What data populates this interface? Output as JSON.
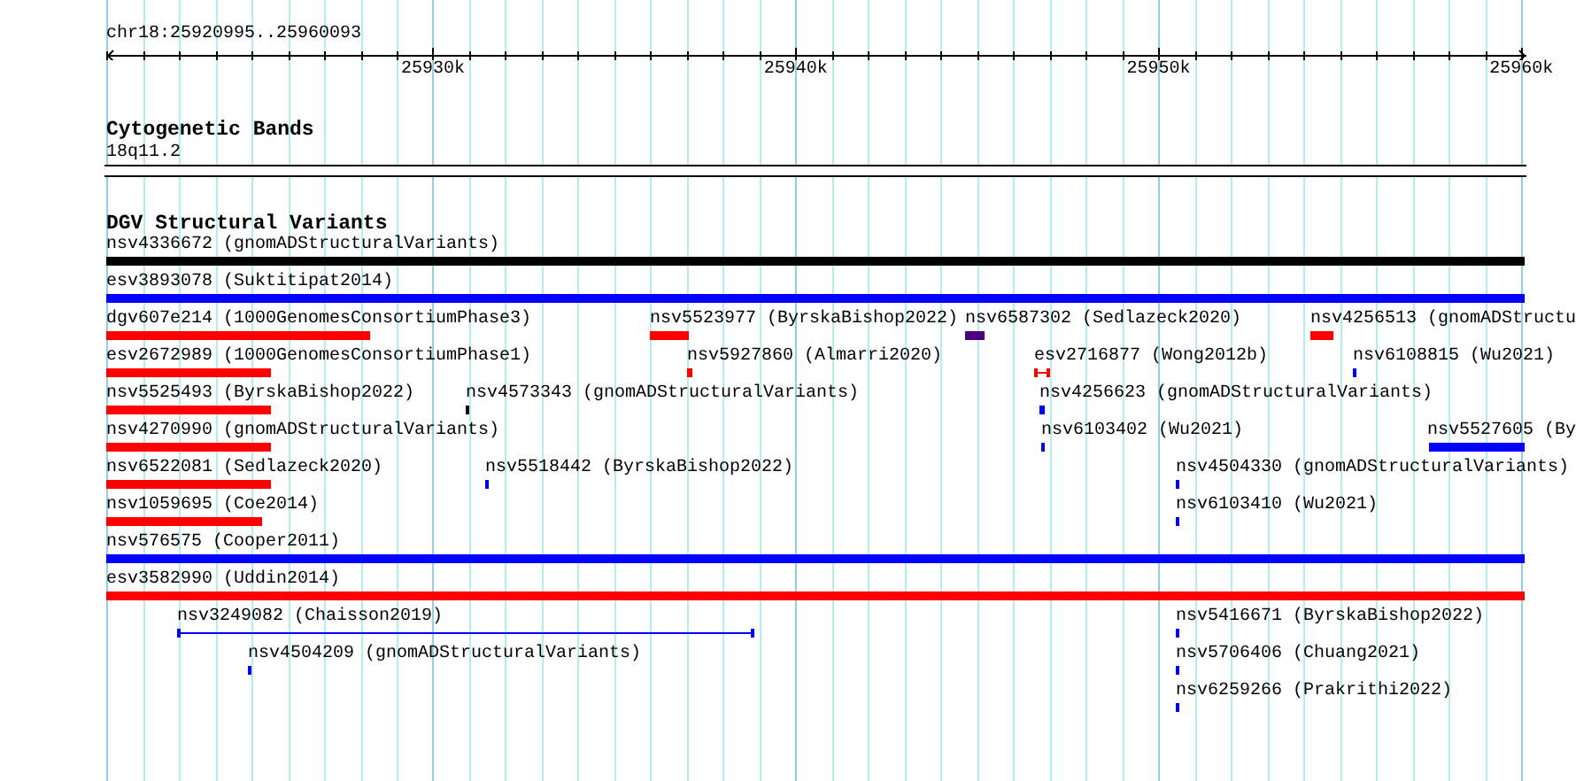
{
  "ruler": {
    "location": "chr18:25920995..25960093",
    "ticks": [
      {
        "label": "25930k"
      },
      {
        "label": "25940k"
      },
      {
        "label": "25950k"
      },
      {
        "label": "25960k"
      }
    ]
  },
  "tracks": [
    {
      "title": "Cytogenetic Bands",
      "kind": "cytoband",
      "bands": [
        {
          "label": "18q11.2"
        }
      ]
    },
    {
      "title": "DGV Structural Variants",
      "kind": "variants",
      "rows": [
        [
          {
            "label": "nsv4336672 (gnomADStructuralVariants)",
            "color": "#000000",
            "kind": "bar"
          }
        ],
        [
          {
            "label": "esv3893078 (Suktitipat2014)",
            "color": "#0000ff",
            "kind": "bar"
          }
        ],
        [
          {
            "label": "dgv607e214 (1000GenomesConsortiumPhase3)",
            "color": "#ff0000",
            "kind": "bar"
          },
          {
            "label": "nsv5523977 (ByrskaBishop2022)",
            "color": "#ff0000",
            "kind": "bar"
          },
          {
            "label": "nsv6587302 (Sedlazeck2020)",
            "color": "#4b0082",
            "kind": "bar"
          },
          {
            "label": "nsv4256513 (gnomADStructu",
            "color": "#ff0000",
            "kind": "bar"
          }
        ],
        [
          {
            "label": "esv2672989 (1000GenomesConsortiumPhase1)",
            "color": "#ff0000",
            "kind": "bar"
          },
          {
            "label": "nsv5927860 (Almarri2020)",
            "color": "#ff0000",
            "kind": "bar"
          },
          {
            "label": "esv2716877 (Wong2012b)",
            "color": "#ff0000",
            "kind": "span"
          },
          {
            "label": "nsv6108815 (Wu2021)",
            "color": "#0000ff",
            "kind": "bar"
          }
        ],
        [
          {
            "label": "nsv5525493 (ByrskaBishop2022)",
            "color": "#ff0000",
            "kind": "bar"
          },
          {
            "label": "nsv4573343 (gnomADStructuralVariants)",
            "color": "#000000",
            "kind": "bar"
          },
          {
            "label": "nsv4256623 (gnomADStructuralVariants)",
            "color": "#0000ff",
            "kind": "bar"
          }
        ],
        [
          {
            "label": "nsv4270990 (gnomADStructuralVariants)",
            "color": "#ff0000",
            "kind": "bar"
          },
          {
            "label": "nsv6103402 (Wu2021)",
            "color": "#0000ff",
            "kind": "bar"
          },
          {
            "label": "nsv5527605 (By",
            "color": "#0000ff",
            "kind": "bar"
          }
        ],
        [
          {
            "label": "nsv6522081 (Sedlazeck2020)",
            "color": "#ff0000",
            "kind": "bar"
          },
          {
            "label": "nsv5518442 (ByrskaBishop2022)",
            "color": "#0000ff",
            "kind": "bar"
          },
          {
            "label": "nsv4504330 (gnomADStructuralVariants)",
            "color": "#0000ff",
            "kind": "bar"
          }
        ],
        [
          {
            "label": "nsv1059695 (Coe2014)",
            "color": "#ff0000",
            "kind": "bar"
          },
          {
            "label": "nsv6103410 (Wu2021)",
            "color": "#0000ff",
            "kind": "bar"
          }
        ],
        [
          {
            "label": "nsv576575 (Cooper2011)",
            "color": "#0000ff",
            "kind": "bar"
          }
        ],
        [
          {
            "label": "esv3582990 (Uddin2014)",
            "color": "#ff0000",
            "kind": "bar"
          }
        ],
        [
          {
            "label": "nsv3249082 (Chaisson2019)",
            "color": "#0000ff",
            "kind": "span"
          },
          {
            "label": "nsv5416671 (ByrskaBishop2022)",
            "color": "#0000ff",
            "kind": "bar"
          }
        ],
        [
          {
            "label": "nsv4504209 (gnomADStructuralVariants)",
            "color": "#0000ff",
            "kind": "bar"
          },
          {
            "label": "nsv5706406 (Chuang2021)",
            "color": "#0000ff",
            "kind": "bar"
          }
        ],
        [
          {
            "label": "nsv6259266 (Prakrithi2022)",
            "color": "#0000ff",
            "kind": "bar"
          }
        ]
      ]
    }
  ]
}
